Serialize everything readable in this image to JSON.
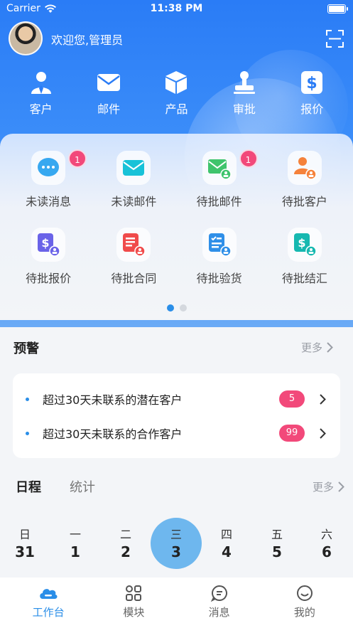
{
  "status_bar": {
    "carrier": "Carrier",
    "time": "11:38 PM"
  },
  "header": {
    "welcome": "欢迎您,管理员"
  },
  "top_nav": [
    {
      "label": "客户",
      "icon": "customer-icon"
    },
    {
      "label": "邮件",
      "icon": "mail-icon"
    },
    {
      "label": "产品",
      "icon": "product-box-icon"
    },
    {
      "label": "审批",
      "icon": "approval-stamp-icon"
    },
    {
      "label": "报价",
      "icon": "quote-dollar-icon"
    }
  ],
  "quick_grid": [
    {
      "label": "未读消息",
      "icon": "chat-bubble-icon",
      "badge": "1"
    },
    {
      "label": "未读邮件",
      "icon": "envelope-icon"
    },
    {
      "label": "待批邮件",
      "icon": "mail-approval-icon",
      "badge": "1"
    },
    {
      "label": "待批客户",
      "icon": "customer-approval-icon"
    },
    {
      "label": "待批报价",
      "icon": "quote-approval-icon"
    },
    {
      "label": "待批合同",
      "icon": "contract-approval-icon"
    },
    {
      "label": "待批验货",
      "icon": "inspection-approval-icon"
    },
    {
      "label": "待批结汇",
      "icon": "settlement-approval-icon"
    }
  ],
  "pager": {
    "current_page": 1,
    "total_pages": 2
  },
  "alerts": {
    "title": "预警",
    "more": "更多",
    "items": [
      {
        "text": "超过30天未联系的潜在客户",
        "count": "5"
      },
      {
        "text": "超过30天未联系的合作客户",
        "count": "99"
      }
    ]
  },
  "schedule": {
    "tabs": [
      "日程",
      "统计"
    ],
    "active_tab": "日程",
    "more": "更多",
    "days": [
      {
        "weekday": "日",
        "date": "31"
      },
      {
        "weekday": "一",
        "date": "1"
      },
      {
        "weekday": "二",
        "date": "2"
      },
      {
        "weekday": "三",
        "date": "3",
        "today": true
      },
      {
        "weekday": "四",
        "date": "4"
      },
      {
        "weekday": "五",
        "date": "5"
      },
      {
        "weekday": "六",
        "date": "6"
      }
    ]
  },
  "tab_bar": [
    {
      "label": "工作台",
      "icon": "workbench-cloud-icon",
      "active": true
    },
    {
      "label": "模块",
      "icon": "modules-grid-icon"
    },
    {
      "label": "消息",
      "icon": "message-bubble-icon"
    },
    {
      "label": "我的",
      "icon": "profile-smile-icon"
    }
  ],
  "colors": {
    "primary": "#2a7cf6",
    "accent": "#2a8ee8",
    "badge": "#f2497a",
    "today": "#6eb7ee"
  }
}
